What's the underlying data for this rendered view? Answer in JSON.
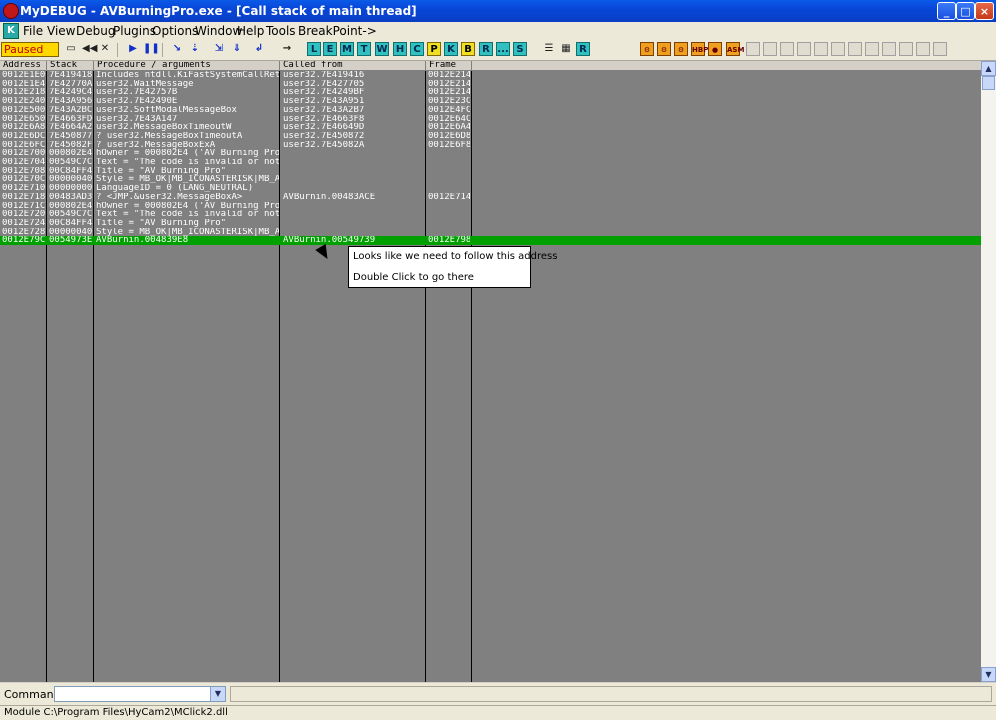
{
  "window": {
    "title": "MyDEBUG - AVBurningPro.exe - [Call stack of main thread]",
    "min_label": "_",
    "max_label": "□",
    "close_label": "×"
  },
  "menu": [
    "File",
    "View",
    "Debug",
    "Plugins",
    "Options",
    "Window",
    "Help",
    "Tools",
    "BreakPoint->"
  ],
  "mdi": {
    "min": "_",
    "restore": "▭",
    "close": "×"
  },
  "toolbar": {
    "status": "Paused",
    "letters": [
      "L",
      "E",
      "M",
      "T",
      "W",
      "H",
      "C",
      "P",
      "K",
      "B",
      "R",
      "...",
      "S"
    ]
  },
  "table": {
    "headers": {
      "address": "Address",
      "stack": "Stack",
      "procedure": "Procedure / arguments",
      "called_from": "Called from",
      "frame": "Frame"
    },
    "rows": [
      {
        "address": "0012E1E0",
        "stack": "7E419418",
        "procedure": "Includes ntdll.KiFastSystemCallRet",
        "called_from": "user32.7E419416",
        "frame": "0012E214"
      },
      {
        "address": "0012E1E4",
        "stack": "7E42770A",
        "procedure": "user32.WaitMessage",
        "called_from": "user32.7E427705",
        "frame": "0012E214"
      },
      {
        "address": "0012E218",
        "stack": "7E4249C4",
        "procedure": "user32.7E42757B",
        "called_from": "user32.7E4249BF",
        "frame": "0012E214"
      },
      {
        "address": "0012E240",
        "stack": "7E43A956",
        "procedure": "user32.7E42490E",
        "called_from": "user32.7E43A951",
        "frame": "0012E23C"
      },
      {
        "address": "0012E500",
        "stack": "7E43A2BC",
        "procedure": "user32.SoftModalMessageBox",
        "called_from": "user32.7E43A2B7",
        "frame": "0012E4FC"
      },
      {
        "address": "0012E650",
        "stack": "7E4663FD",
        "procedure": "user32.7E43A147",
        "called_from": "user32.7E4663F8",
        "frame": "0012E64C"
      },
      {
        "address": "0012E6A8",
        "stack": "7E4664A2",
        "procedure": "user32.MessageBoxTimeoutW",
        "called_from": "user32.7E46649D",
        "frame": "0012E6A4"
      },
      {
        "address": "0012E6DC",
        "stack": "7E450877",
        "procedure": "? user32.MessageBoxTimeoutA",
        "called_from": "user32.7E450872",
        "frame": "0012E6D8"
      },
      {
        "address": "0012E6FC",
        "stack": "7E45082F",
        "procedure": "? user32.MessageBoxExA",
        "called_from": "user32.7E45082A",
        "frame": "0012E6F8"
      },
      {
        "address": "0012E700",
        "stack": "000802E4",
        "procedure": "  hOwner = 000802E4 ('AV Burning Pro'",
        "called_from": "",
        "frame": ""
      },
      {
        "address": "0012E704",
        "stack": "00549C7C0",
        "procedure": "  Text = \"The code is invalid or not",
        "called_from": "",
        "frame": ""
      },
      {
        "address": "0012E708",
        "stack": "00C84FF4",
        "procedure": "  Title = \"AV Burning Pro\"",
        "called_from": "",
        "frame": ""
      },
      {
        "address": "0012E70C",
        "stack": "00000040",
        "procedure": "  Style = MB_OK|MB_ICONASTERISK|MB_A",
        "called_from": "",
        "frame": ""
      },
      {
        "address": "0012E710",
        "stack": "00000000",
        "procedure": "  LanguageID = 0 (LANG_NEUTRAL)",
        "called_from": "",
        "frame": ""
      },
      {
        "address": "0012E718",
        "stack": "00483AD3",
        "procedure": "? <JMP.&user32.MessageBoxA>",
        "called_from": "AVBurnin.00483ACE",
        "frame": "0012E714"
      },
      {
        "address": "0012E71C",
        "stack": "000802E4",
        "procedure": "  hOwner = 000802E4 ('AV Burning Pro'",
        "called_from": "",
        "frame": ""
      },
      {
        "address": "0012E720",
        "stack": "00549C7C0",
        "procedure": "  Text = \"The code is invalid or not",
        "called_from": "",
        "frame": ""
      },
      {
        "address": "0012E724",
        "stack": "00C84FF4",
        "procedure": "  Title = \"AV Burning Pro\"",
        "called_from": "",
        "frame": ""
      },
      {
        "address": "0012E728",
        "stack": "00000040",
        "procedure": "  Style = MB_OK|MB_ICONASTERISK|MB_A",
        "called_from": "",
        "frame": ""
      },
      {
        "address": "0012E79C",
        "stack": "0054973E",
        "procedure": "  AVBurnin.004839E8",
        "called_from": "AVBurnin.00549739",
        "frame": "0012E798"
      }
    ]
  },
  "tooltip": {
    "line1": "Looks like we need to follow this address",
    "line2": "Double Click to go there"
  },
  "command": {
    "label": "Command :",
    "value": ""
  },
  "statusbar": {
    "text": "Module C:\\Program Files\\HyCam2\\MClick2.dll"
  },
  "colors": {
    "titlebar": "#0a46d8",
    "grid_bg": "#808080",
    "selected_row": "#00a000",
    "paused": "#ffd800"
  }
}
